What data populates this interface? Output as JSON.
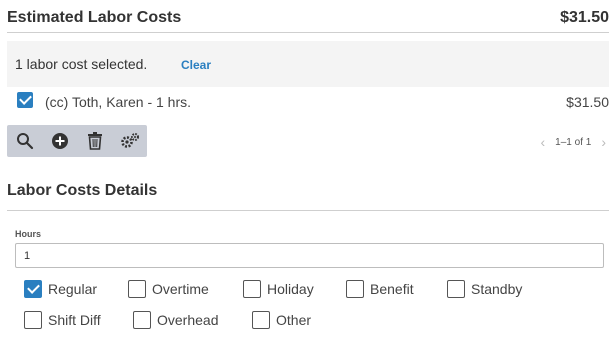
{
  "header": {
    "title": "Estimated Labor Costs",
    "total": "$31.50"
  },
  "selection": {
    "text": "1 labor cost selected.",
    "clear_label": "Clear"
  },
  "labor_items": [
    {
      "label": "(cc) Toth, Karen - 1 hrs.",
      "amount": "$31.50",
      "checked": true
    }
  ],
  "toolbar": {
    "icons": [
      "search-icon",
      "add-icon",
      "delete-icon",
      "settings-icon"
    ]
  },
  "pager": {
    "text": "1–1 of 1"
  },
  "details": {
    "title": "Labor Costs Details",
    "hours_label": "Hours",
    "hours_value": "1"
  },
  "options": [
    {
      "label": "Regular",
      "checked": true
    },
    {
      "label": "Overtime",
      "checked": false
    },
    {
      "label": "Holiday",
      "checked": false
    },
    {
      "label": "Benefit",
      "checked": false
    },
    {
      "label": "Standby",
      "checked": false
    },
    {
      "label": "Shift Diff",
      "checked": false
    },
    {
      "label": "Overhead",
      "checked": false
    },
    {
      "label": "Other",
      "checked": false
    }
  ],
  "colors": {
    "accent": "#2a7fc0",
    "toolbar": "#c9cdd6",
    "selection_bg": "#f4f4f4"
  }
}
